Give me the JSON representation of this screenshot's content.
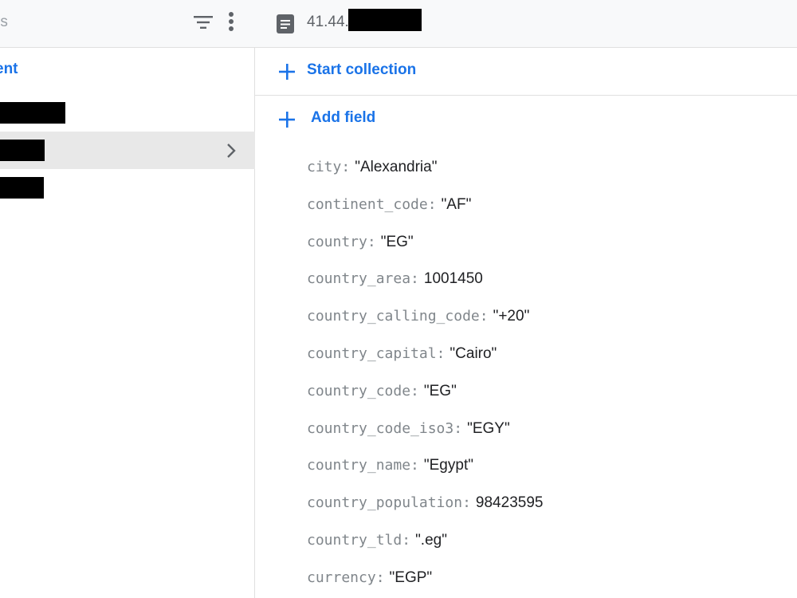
{
  "left_panel": {
    "header_text": "rs",
    "add_document_label": "ent",
    "filter_icon": "filter-list-icon",
    "more_icon": "more-vert-icon",
    "chevron_icon": "chevron-right-icon",
    "documents": [
      {
        "redacted": true,
        "selected": false
      },
      {
        "redacted": true,
        "selected": true
      },
      {
        "redacted": true,
        "selected": false
      }
    ]
  },
  "right_panel": {
    "doc_icon": "document-icon",
    "doc_path": "41.44.",
    "doc_path_redacted": true,
    "start_collection_label": "Start collection",
    "add_field_label": "Add field",
    "plus_icon": "plus-icon",
    "fields": [
      {
        "key": "city",
        "value": "\"Alexandria\""
      },
      {
        "key": "continent_code",
        "value": "\"AF\""
      },
      {
        "key": "country",
        "value": "\"EG\""
      },
      {
        "key": "country_area",
        "value": "1001450"
      },
      {
        "key": "country_calling_code",
        "value": "\"+20\""
      },
      {
        "key": "country_capital",
        "value": "\"Cairo\""
      },
      {
        "key": "country_code",
        "value": "\"EG\""
      },
      {
        "key": "country_code_iso3",
        "value": "\"EGY\""
      },
      {
        "key": "country_name",
        "value": "\"Egypt\""
      },
      {
        "key": "country_population",
        "value": "98423595"
      },
      {
        "key": "country_tld",
        "value": "\".eg\""
      },
      {
        "key": "currency",
        "value": "\"EGP\""
      }
    ]
  },
  "colors": {
    "accent": "#1a73e8",
    "key_gray": "#80868b",
    "selected_row": "#e8e8e8",
    "header_bg": "#f8f9fa"
  }
}
